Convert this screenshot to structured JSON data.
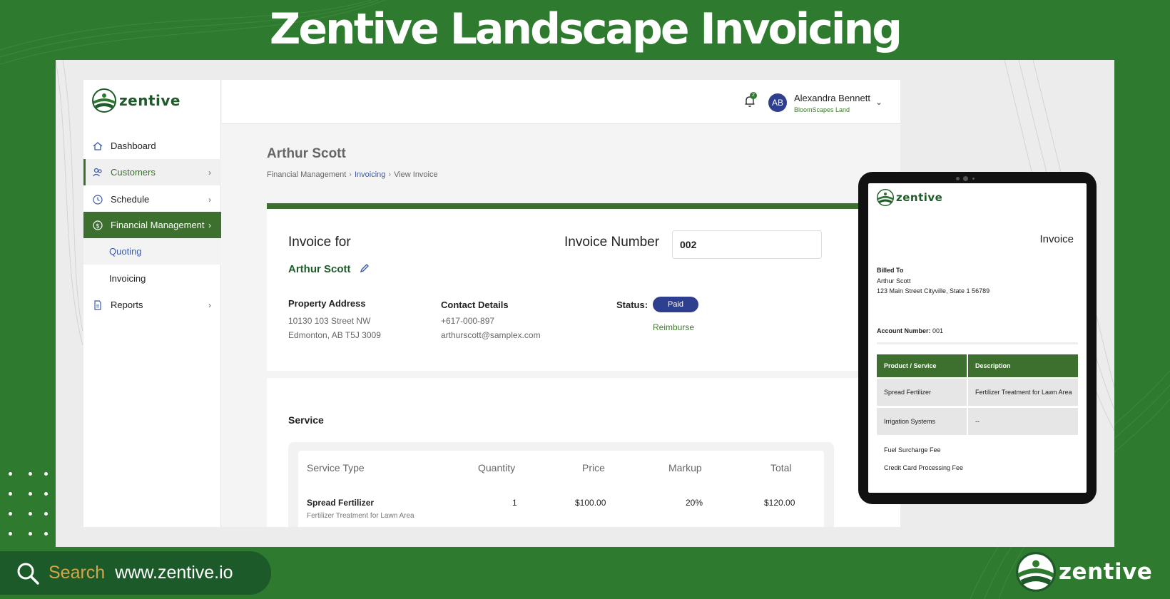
{
  "banner": {
    "title": "Zentive Landscape Invoicing"
  },
  "brand": {
    "logo_text": "zentive",
    "accent": "#3d6f2e",
    "bg": "#2e7a2e"
  },
  "sidebar": {
    "items": [
      {
        "label": "Dashboard",
        "icon": "home-icon"
      },
      {
        "label": "Customers",
        "icon": "users-icon"
      },
      {
        "label": "Schedule",
        "icon": "clock-icon"
      },
      {
        "label": "Financial Management",
        "icon": "dollar-icon"
      },
      {
        "label": "Quoting"
      },
      {
        "label": "Invoicing"
      },
      {
        "label": "Reports",
        "icon": "report-icon"
      }
    ]
  },
  "topbar": {
    "notification_count": "2",
    "avatar_initials": "AB",
    "user_name": "Alexandra Bennett",
    "user_org": "BloomScapes Land"
  },
  "page": {
    "title": "Arthur Scott",
    "breadcrumb": [
      "Financial Management",
      "Invoicing",
      "View Invoice"
    ]
  },
  "invoice": {
    "invoice_for_label": "Invoice for",
    "customer_name": "Arthur Scott",
    "invoice_number_label": "Invoice Number",
    "invoice_number": "002",
    "property_address_label": "Property Address",
    "address_line1": "10130 103 Street NW",
    "address_line2": "Edmonton, AB T5J 3009",
    "contact_label": "Contact Details",
    "phone": "+617-000-897",
    "email": "arthurscott@samplex.com",
    "status_label": "Status:",
    "status": "Paid",
    "reimburse": "Reimburse"
  },
  "service": {
    "title": "Service",
    "columns": [
      "Service Type",
      "Quantity",
      "Price",
      "Markup",
      "Total"
    ],
    "rows": [
      {
        "type": "Spread Fertilizer",
        "desc": "Fertilizer Treatment for Lawn Area",
        "quantity": "1",
        "price": "$100.00",
        "markup": "20%",
        "total": "$120.00"
      }
    ]
  },
  "tablet": {
    "title": "Invoice",
    "billed_to_label": "Billed To",
    "billed_name": "Arthur Scott",
    "billed_address": "123 Main Street Cityville, State 1  56789",
    "account_label": "Account Number:",
    "account_number": "001",
    "columns": [
      "Product / Service",
      "Description"
    ],
    "rows": [
      {
        "product": "Spread Fertilizer",
        "description": "Fertilizer Treatment for Lawn Area"
      },
      {
        "product": "Irrigation Systems",
        "description": "--"
      }
    ],
    "fees": [
      "Fuel Surcharge Fee",
      "Credit Card Processing Fee"
    ]
  },
  "footer": {
    "search_word": "Search",
    "url": "www.zentive.io",
    "logo_text": "zentive"
  }
}
